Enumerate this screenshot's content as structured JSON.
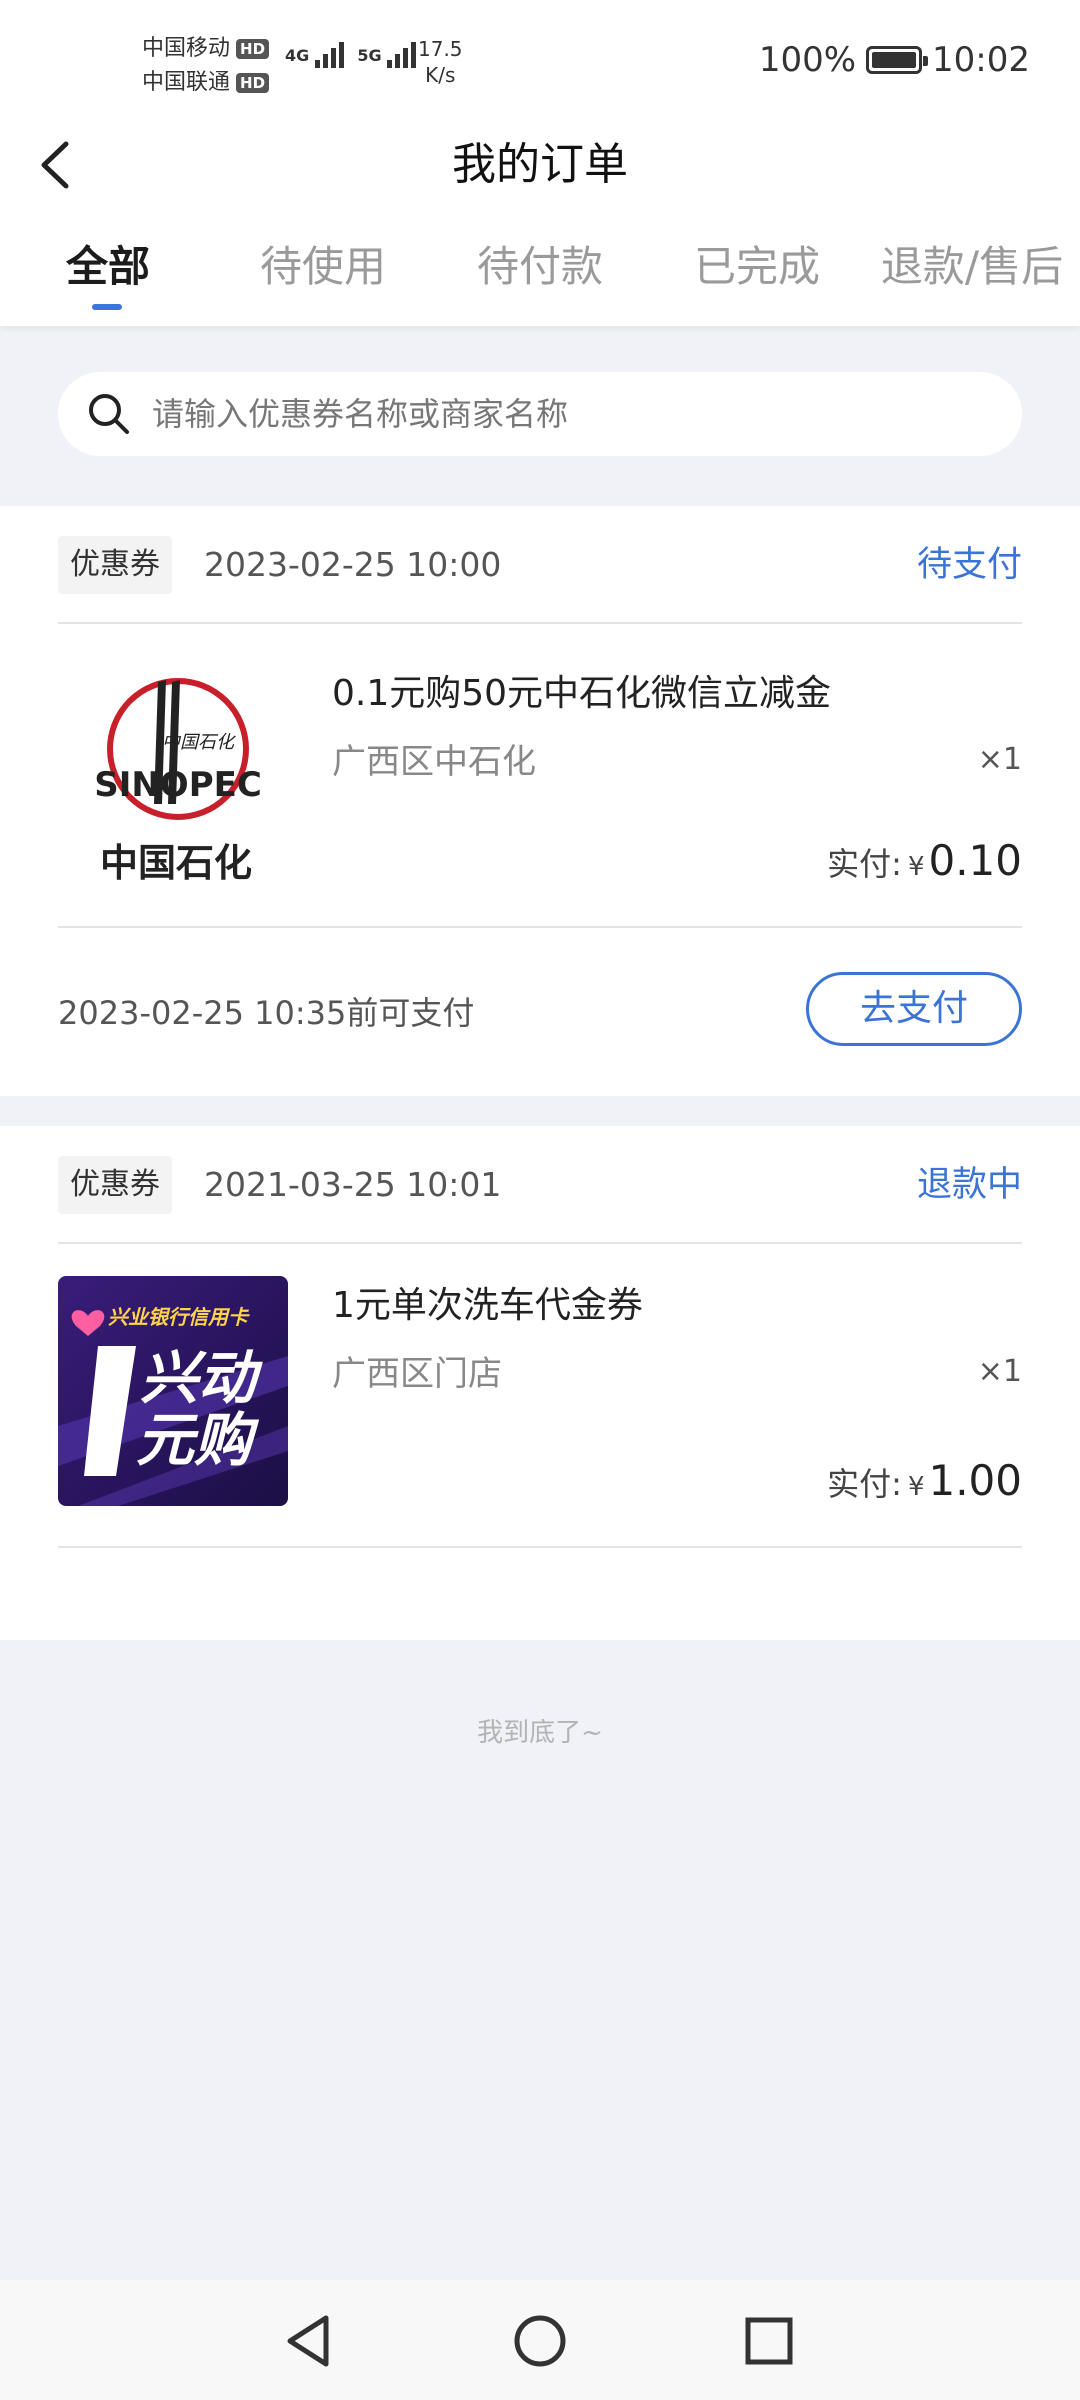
{
  "status_bar": {
    "carrier1": "中国移动",
    "carrier2": "中国联通",
    "hd": "HD",
    "net1": "4G",
    "net2": "5G",
    "speed_value": "17.5",
    "speed_unit": "K/s",
    "battery": "100%",
    "time": "10:02"
  },
  "header": {
    "title": "我的订单",
    "back_icon": "chevron-left-icon"
  },
  "tabs": [
    {
      "label": "全部",
      "active": true
    },
    {
      "label": "待使用",
      "active": false
    },
    {
      "label": "待付款",
      "active": false
    },
    {
      "label": "已完成",
      "active": false
    },
    {
      "label": "退款/售后",
      "active": false
    }
  ],
  "search": {
    "placeholder": "请输入优惠券名称或商家名称",
    "icon": "search-icon"
  },
  "orders": [
    {
      "tag": "优惠券",
      "time": "2023-02-25 10:00",
      "status": "待支付",
      "product_name": "0.1元购50元中石化微信立减金",
      "shop": "广西区中石化",
      "quantity": "×1",
      "paid_label": "实付:",
      "currency": "¥",
      "amount": "0.10",
      "logo_text": "中国石化",
      "logo_brand": "SINOPEC",
      "logo_script": "中国石化",
      "deadline": "2023-02-25 10:35前可支付",
      "action": "去支付"
    },
    {
      "tag": "优惠券",
      "time": "2021-03-25 10:01",
      "status": "退款中",
      "product_name": "1元单次洗车代金券",
      "shop": "广西区门店",
      "quantity": "×1",
      "paid_label": "实付:",
      "currency": "¥",
      "amount": "1.00",
      "image_top": "兴业银行信用卡",
      "image_main1": "兴动",
      "image_main2": "元购"
    }
  ],
  "end_note": "我到底了~",
  "nav": {
    "back": "nav-back-icon",
    "home": "nav-home-icon",
    "recents": "nav-recents-icon"
  },
  "colors": {
    "accent": "#3b73d6",
    "background": "#f1f2f7",
    "sinopec_red": "#c8202a"
  }
}
